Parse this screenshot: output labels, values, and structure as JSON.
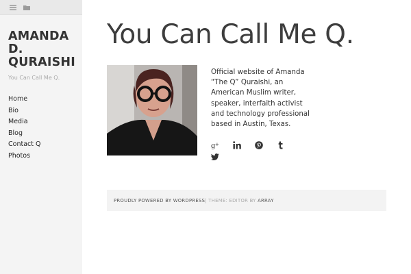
{
  "sidebar": {
    "toolbar": {
      "menu_icon": "menu-icon",
      "folder_icon": "folder-icon"
    },
    "site_title_lines": [
      "AMANDA",
      "D.",
      "QURAISHI"
    ],
    "tagline": "You Can Call Me Q.",
    "nav": [
      {
        "label": "Home"
      },
      {
        "label": "Bio"
      },
      {
        "label": "Media"
      },
      {
        "label": "Blog"
      },
      {
        "label": "Contact Q"
      },
      {
        "label": "Photos"
      }
    ]
  },
  "main": {
    "title": "You Can Call Me Q.",
    "bio": "Official website of Amanda “The Q” Quraishi, an American Muslim writer, speaker, interfaith activist and technology professional based in Austin, Texas.",
    "social": [
      "google-plus-icon",
      "linkedin-icon",
      "pinterest-icon",
      "tumblr-icon",
      "twitter-icon"
    ]
  },
  "footer": {
    "powered_by": "Proudly Powered by WordPress",
    "separator": "|",
    "theme_text": " Theme: Editor by ",
    "author": "Array"
  },
  "colors": {
    "sidebar_bg": "#f4f4f4",
    "toolbar_bg": "#e9e9e9",
    "text": "#333333",
    "muted": "#aaaaaa",
    "footer_bg": "#f3f3f3"
  }
}
